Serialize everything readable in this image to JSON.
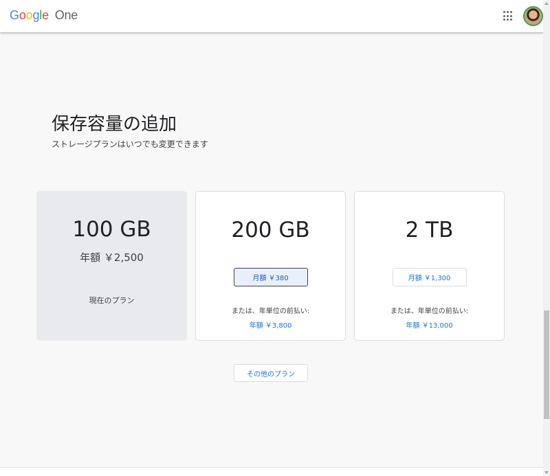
{
  "header": {
    "logo_google": "Google",
    "logo_product": "One",
    "apps_icon": "apps-grid-icon",
    "avatar_icon": "account-avatar"
  },
  "colors": {
    "accent": "#1a73e8",
    "page_bg": "#f8f8f8",
    "current_card_bg": "#e8eaed",
    "selected_button_bg": "#e8f0fe"
  },
  "main": {
    "title": "保存容量の追加",
    "subtitle": "ストレージプランはいつでも変更できます",
    "plans": [
      {
        "size": "100 GB",
        "annual_price": "年額 ￥2,500",
        "status": "現在のプラン",
        "current": true
      },
      {
        "size": "200 GB",
        "monthly_label": "月額 ￥380",
        "prepay_text": "または、年単位の前払い:",
        "annual_label": "年額 ￥3,800",
        "selected": true
      },
      {
        "size": "2 TB",
        "monthly_label": "月額 ￥1,300",
        "prepay_text": "または、年単位の前払い:",
        "annual_label": "年額 ￥13,000",
        "selected": false
      }
    ],
    "other_plans_label": "その他のプラン"
  }
}
